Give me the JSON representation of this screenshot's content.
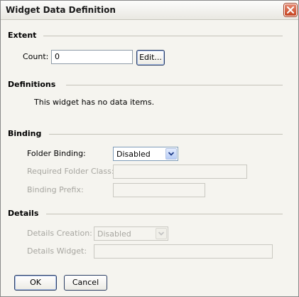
{
  "window": {
    "title": "Widget Data Definition"
  },
  "extent": {
    "header": "Extent",
    "count_label": "Count:",
    "count_value": "0",
    "edit_button": "Edit..."
  },
  "definitions": {
    "header": "Definitions",
    "message": "This widget has no data items."
  },
  "binding": {
    "header": "Binding",
    "folder_binding_label": "Folder Binding:",
    "folder_binding_value": "Disabled",
    "required_folder_class_label": "Required Folder Class:",
    "required_folder_class_value": "",
    "binding_prefix_label": "Binding Prefix:",
    "binding_prefix_value": ""
  },
  "details": {
    "header": "Details",
    "details_creation_label": "Details Creation:",
    "details_creation_value": "Disabled",
    "details_widget_label": "Details Widget:",
    "details_widget_value": ""
  },
  "buttons": {
    "ok": "OK",
    "cancel": "Cancel"
  },
  "icons": {
    "close": "close-icon",
    "dropdown": "chevron-down-icon"
  },
  "colors": {
    "close_button": "#c5431f",
    "dialog_background": "#f5f4ef",
    "disabled_text": "#a7a6a0"
  }
}
